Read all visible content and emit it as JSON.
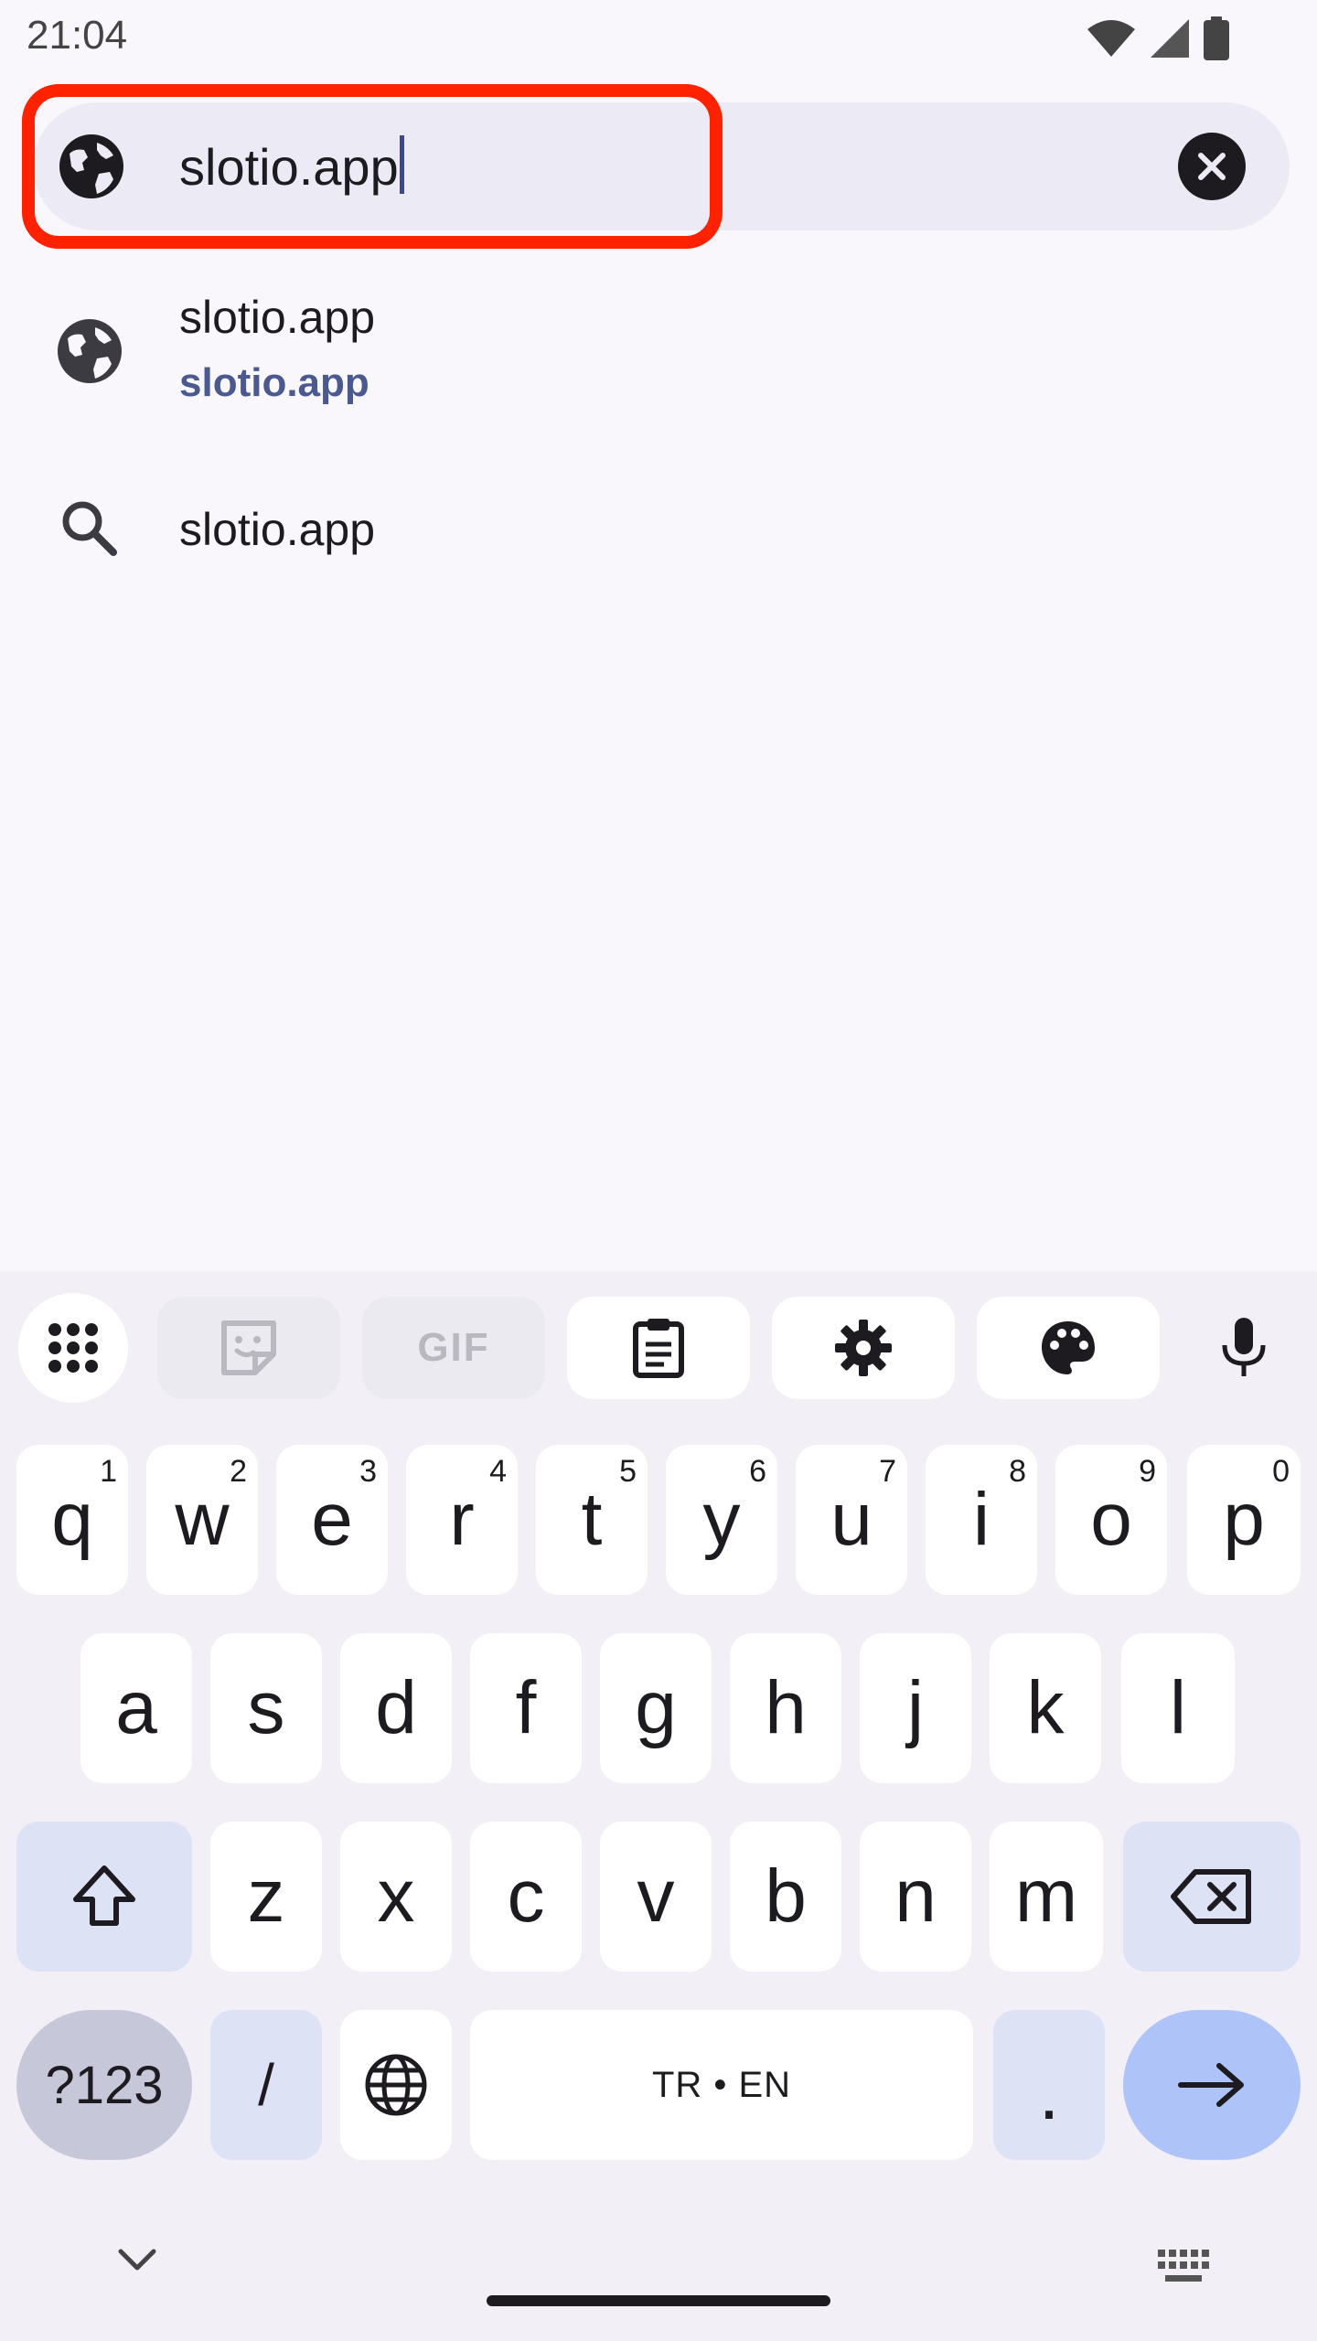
{
  "status_bar": {
    "time": "21:04",
    "icons": [
      "wifi-icon",
      "cellular-signal-icon",
      "battery-icon"
    ]
  },
  "omnibox": {
    "value": "slotio.app",
    "leading_icon": "globe-icon",
    "trailing_icon": "clear-icon"
  },
  "suggestions": [
    {
      "icon": "globe-icon",
      "title": "slotio.app",
      "url": "slotio.app"
    },
    {
      "icon": "search-icon",
      "title": "slotio.app"
    }
  ],
  "keyboard": {
    "toolbar": [
      {
        "name": "apps-grid-icon",
        "enabled": true
      },
      {
        "name": "sticker-icon",
        "enabled": false
      },
      {
        "name": "gif-button",
        "label": "GIF",
        "enabled": false
      },
      {
        "name": "clipboard-icon",
        "enabled": true
      },
      {
        "name": "settings-gear-icon",
        "enabled": true
      },
      {
        "name": "theme-palette-icon",
        "enabled": true
      },
      {
        "name": "microphone-icon",
        "enabled": true
      }
    ],
    "row1": [
      {
        "key": "q",
        "hint": "1"
      },
      {
        "key": "w",
        "hint": "2"
      },
      {
        "key": "e",
        "hint": "3"
      },
      {
        "key": "r",
        "hint": "4"
      },
      {
        "key": "t",
        "hint": "5"
      },
      {
        "key": "y",
        "hint": "6"
      },
      {
        "key": "u",
        "hint": "7"
      },
      {
        "key": "i",
        "hint": "8"
      },
      {
        "key": "o",
        "hint": "9"
      },
      {
        "key": "p",
        "hint": "0"
      }
    ],
    "row2": [
      "a",
      "s",
      "d",
      "f",
      "g",
      "h",
      "j",
      "k",
      "l"
    ],
    "row3": [
      "z",
      "x",
      "c",
      "v",
      "b",
      "n",
      "m"
    ],
    "symbols_label": "?123",
    "slash_label": "/",
    "space_label": "TR • EN",
    "period_label": ".",
    "colors": {
      "accent_enter": "#aec3f7",
      "special_key": "#dde2f5",
      "highlight": "#ff2200",
      "url_text": "#4a5a8e"
    }
  }
}
